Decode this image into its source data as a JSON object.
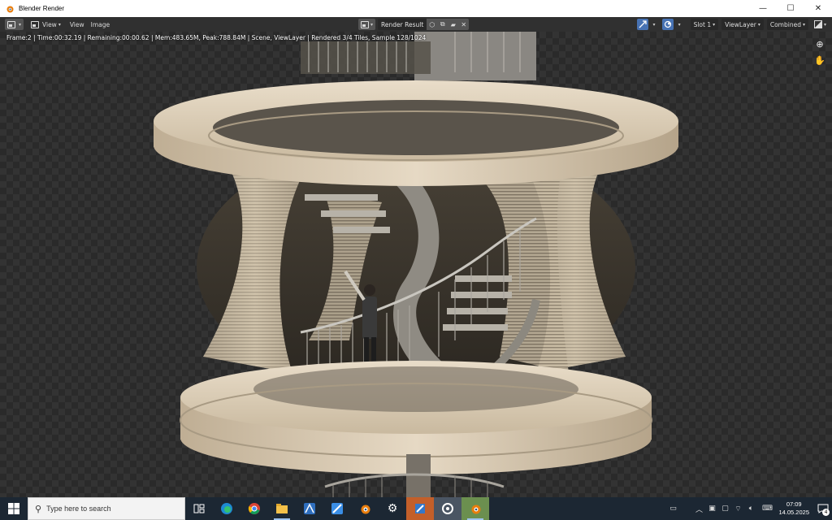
{
  "window": {
    "title": "Blender Render",
    "controls": [
      "—",
      "☐",
      "✕"
    ]
  },
  "header": {
    "menus": [
      "View",
      "View",
      "Image"
    ],
    "image_name": "Render Result",
    "slot": "Slot 1",
    "view_layer": "ViewLayer",
    "pass": "Combined"
  },
  "viewport": {
    "stats": "Frame:2 | Time:00:32.19 | Remaining:00:00.62 | Mem:483.65M, Peak:788.84M | Scene, ViewLayer | Rendered 3/4 Tiles, Sample 128/1024"
  },
  "taskbar": {
    "search_placeholder": "Type here to search",
    "clock_time": "07:09",
    "clock_date": "14.05.2025",
    "notification_count": "4",
    "apps": [
      "task-view-icon",
      "edge-icon",
      "chrome-icon",
      "file-explorer-icon",
      "app-icon-1",
      "app-icon-2",
      "blender-icon",
      "settings-icon",
      "app-icon-3",
      "app-icon-4",
      "blender-active-icon"
    ]
  },
  "colors": {
    "accent": "#4772b3",
    "header_bg": "#303030",
    "taskbar_bg": "#1c2733"
  }
}
